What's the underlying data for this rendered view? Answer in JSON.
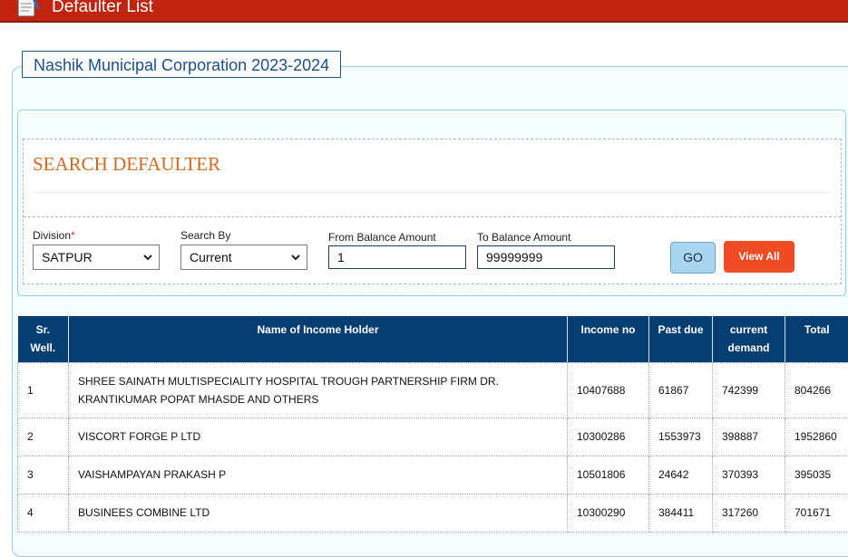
{
  "header": {
    "title": "Defaulter List",
    "logo_icon": "document-pen-icon"
  },
  "corporation": {
    "legend": "Nashik Municipal Corporation 2023-2024"
  },
  "search": {
    "heading": "SEARCH DEFAULTER",
    "division_label": "Division",
    "division_required": "*",
    "division_value": "SATPUR",
    "search_by_label": "Search By",
    "search_by_value": "Current",
    "from_label": "From Balance Amount",
    "from_value": "1",
    "to_label": "To Balance Amount",
    "to_value": "99999999",
    "go_label": "GO",
    "view_all_label": "View All"
  },
  "table": {
    "headers": {
      "sr_line1": "Sr.",
      "sr_line2": "Well.",
      "name": "Name of Income Holder",
      "income_no": "Income no",
      "past_due": "Past due",
      "current_line1": "current",
      "current_line2": "demand",
      "total": "Total"
    },
    "rows": [
      {
        "sr": "1",
        "name": "SHREE SAINATH MULTISPECIALITY HOSPITAL TROUGH PARTNERSHIP FIRM DR. KRANTIKUMAR POPAT MHASDE AND OTHERS",
        "income_no": "10407688",
        "past_due": "61867",
        "current": "742399",
        "total": "804266"
      },
      {
        "sr": "2",
        "name": "VISCORT FORGE P LTD",
        "income_no": "10300286",
        "past_due": "1553973",
        "current": "398887",
        "total": "1952860"
      },
      {
        "sr": "3",
        "name": "VAISHAMPAYAN PRAKASH P",
        "income_no": "10501806",
        "past_due": "24642",
        "current": "370393",
        "total": "395035"
      },
      {
        "sr": "4",
        "name": "BUSINEES COMBINE LTD",
        "income_no": "10300290",
        "past_due": "384411",
        "current": "317260",
        "total": "701671"
      }
    ]
  },
  "colors": {
    "header_bar": "#c1250f",
    "table_header": "#073e71",
    "view_all": "#ef4b25",
    "go_button": "#a9d5f3"
  }
}
